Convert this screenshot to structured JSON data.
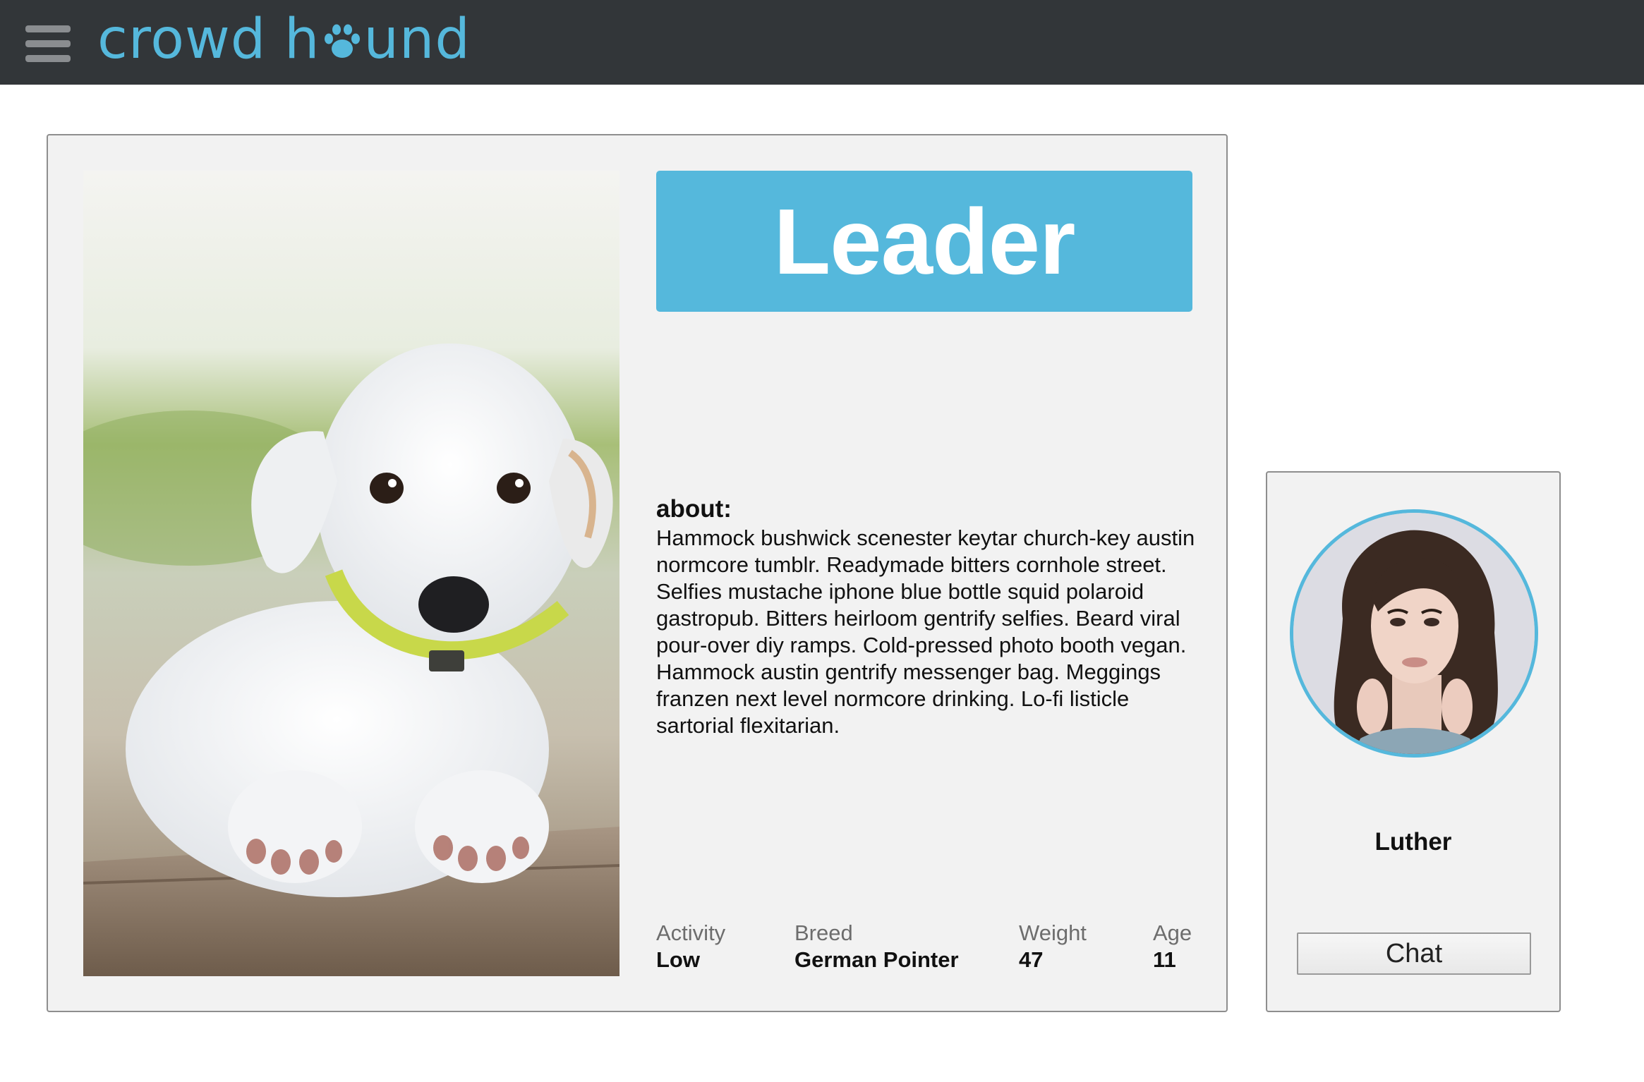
{
  "header": {
    "logo_part1": "crowd h",
    "logo_part2": "und",
    "accent_color": "#55b8dc",
    "bar_color": "#323639",
    "menu_icon": "hamburger-menu-icon",
    "logo_paw_icon": "paw-icon"
  },
  "dog": {
    "photo_icon": "dog-photo",
    "role_badge": "Leader",
    "about_label": "about:",
    "about_text": "Hammock bushwick scenester keytar church-key austin normcore tumblr. Readymade bitters cornhole street. Selfies mustache iphone blue bottle squid polaroid gastropub. Bitters heirloom gentrify selfies. Beard viral pour-over diy ramps. Cold-pressed photo booth vegan. Hammock austin gentrify messenger bag. Meggings franzen next level normcore drinking. Lo-fi listicle sartorial flexitarian.",
    "stats": [
      {
        "label": "Activity",
        "value": "Low"
      },
      {
        "label": "Breed",
        "value": "German Pointer"
      },
      {
        "label": "Weight",
        "value": "47"
      },
      {
        "label": "Age",
        "value": "11"
      }
    ]
  },
  "owner": {
    "avatar_icon": "owner-avatar",
    "name": "Luther",
    "chat_label": "Chat"
  }
}
